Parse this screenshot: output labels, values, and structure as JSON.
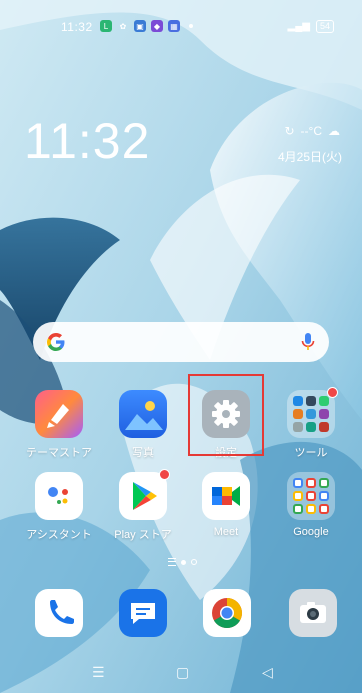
{
  "status_bar": {
    "time": "11:32",
    "battery": "54"
  },
  "lock_widget": {
    "clock": "11:32",
    "weather": "--°C",
    "date": "4月25日(火)"
  },
  "apps": {
    "row1": [
      {
        "label": "テーマストア",
        "icon": "theme-store-icon"
      },
      {
        "label": "写真",
        "icon": "photos-icon"
      },
      {
        "label": "設定",
        "icon": "settings-gear-icon"
      },
      {
        "label": "ツール",
        "icon": "tools-folder-icon"
      }
    ],
    "row2": [
      {
        "label": "アシスタント",
        "icon": "google-assistant-icon"
      },
      {
        "label": "Play ストア",
        "icon": "play-store-icon"
      },
      {
        "label": "Meet",
        "icon": "google-meet-icon"
      },
      {
        "label": "Google",
        "icon": "google-folder-icon"
      }
    ]
  },
  "dock": [
    {
      "icon": "phone-icon"
    },
    {
      "icon": "messages-icon"
    },
    {
      "icon": "chrome-icon"
    },
    {
      "icon": "camera-icon"
    }
  ],
  "colors": {
    "highlight_box": "#e53935",
    "badge": "#f04747"
  }
}
